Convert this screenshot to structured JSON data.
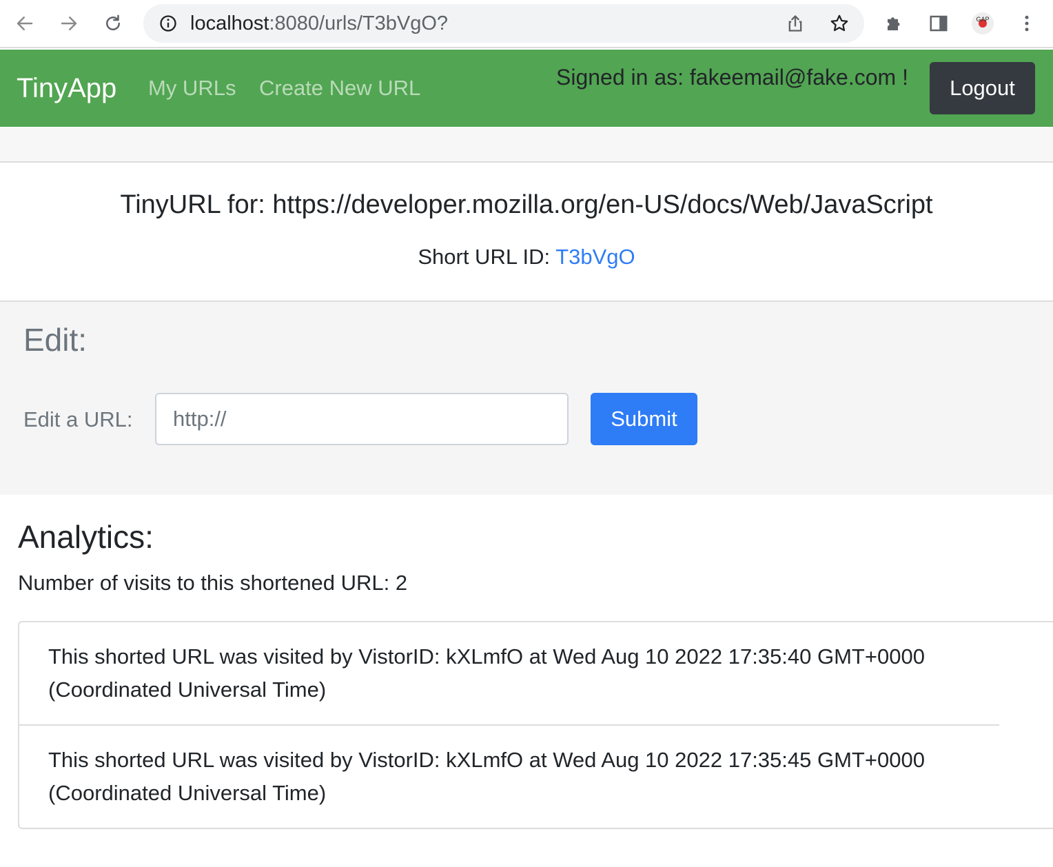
{
  "browser": {
    "url_host": "localhost",
    "url_path": ":8080/urls/T3bVgO?",
    "icons": [
      "back-arrow-icon",
      "forward-arrow-icon",
      "reload-icon",
      "info-icon",
      "share-icon",
      "star-icon",
      "extensions-puzzle-icon",
      "side-panel-icon",
      "profile-avatar-icon",
      "menu-dots-icon"
    ],
    "avatar_text": "GAP"
  },
  "navbar": {
    "brand": "TinyApp",
    "links": [
      "My URLs",
      "Create New URL"
    ],
    "signed_in": "Signed in as: fakeemail@fake.com !",
    "logout_label": "Logout",
    "color": "#52a552"
  },
  "main": {
    "title": "TinyURL for: https://developer.mozilla.org/en-US/docs/Web/JavaScript",
    "short_label": "Short URL ID: ",
    "short_id": "T3bVgO"
  },
  "edit": {
    "heading": "Edit:",
    "label": "Edit a URL:",
    "placeholder": "http://",
    "submit_label": "Submit"
  },
  "analytics": {
    "heading": "Analytics:",
    "visits_text": "Number of visits to this shortened URL: 2",
    "entries": [
      "This shorted URL was visited by VistorID: kXLmfO at Wed Aug 10 2022 17:35:40 GMT+0000 (Coordinated Universal Time)",
      "This shorted URL was visited by VistorID: kXLmfO at Wed Aug 10 2022 17:35:45 GMT+0000 (Coordinated Universal Time)"
    ]
  }
}
